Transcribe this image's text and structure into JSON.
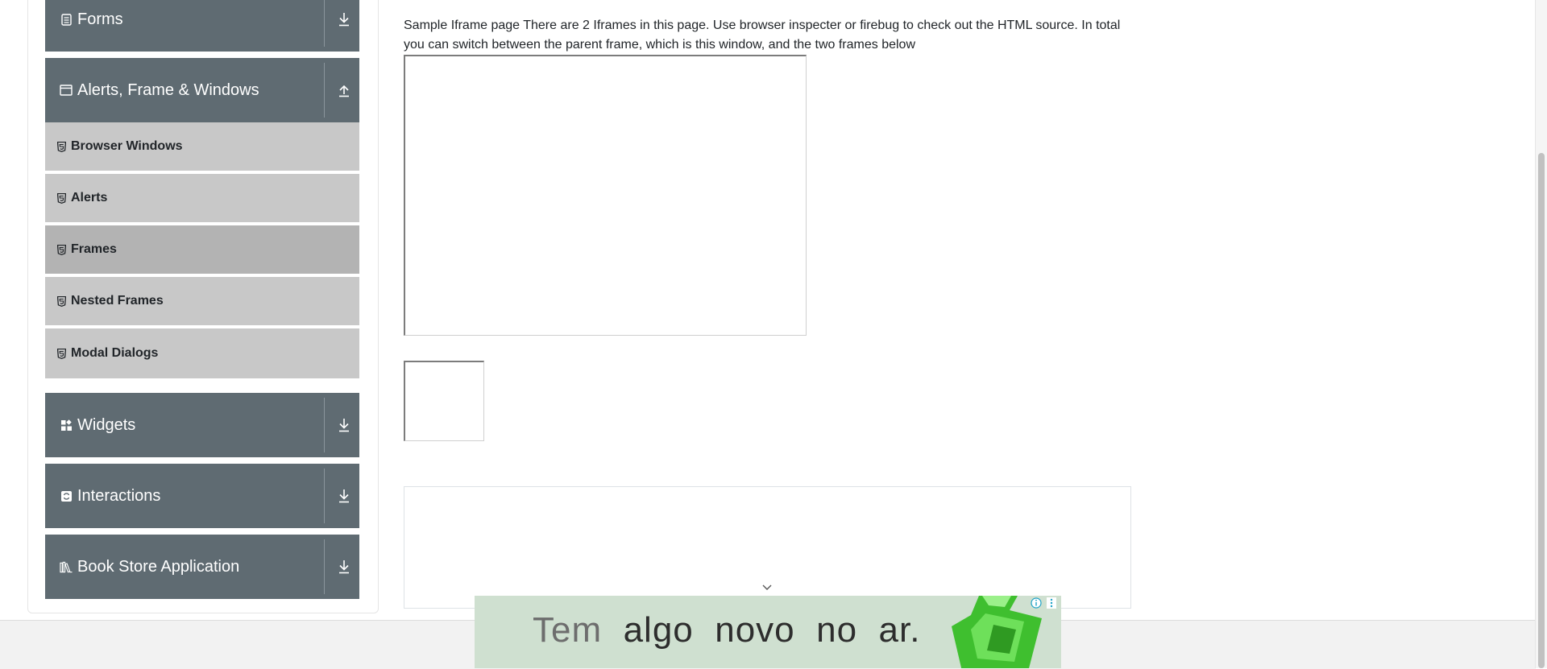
{
  "sidebar": {
    "groups": [
      {
        "label": "Forms",
        "icon": "form-icon",
        "arrow": "download-arrow-icon"
      },
      {
        "label": "Alerts, Frame & Windows",
        "icon": "window-icon",
        "arrow": "upload-arrow-icon"
      },
      {
        "label": "Widgets",
        "icon": "widgets-icon",
        "arrow": "download-arrow-icon"
      },
      {
        "label": "Interactions",
        "icon": "interactions-icon",
        "arrow": "download-arrow-icon"
      },
      {
        "label": "Book Store Application",
        "icon": "books-icon",
        "arrow": "download-arrow-icon"
      }
    ],
    "items": [
      {
        "label": "Browser Windows"
      },
      {
        "label": "Alerts"
      },
      {
        "label": "Frames"
      },
      {
        "label": "Nested Frames"
      },
      {
        "label": "Modal Dialogs"
      }
    ],
    "active_item": "Frames"
  },
  "main": {
    "intro": "Sample Iframe page There are 2 Iframes in this page. Use browser inspecter or firebug to check out the HTML source. In total you can switch between the parent frame, which is this window, and the two frames below"
  },
  "ad": {
    "text_parts": [
      "Tem",
      "algo",
      "novo",
      "no",
      "ar."
    ]
  },
  "colors": {
    "group_header": "#5f6b72",
    "menu_item": "#c8c8c8",
    "menu_item_active": "#b3b3b3",
    "ad_background": "#cfe0d0"
  }
}
